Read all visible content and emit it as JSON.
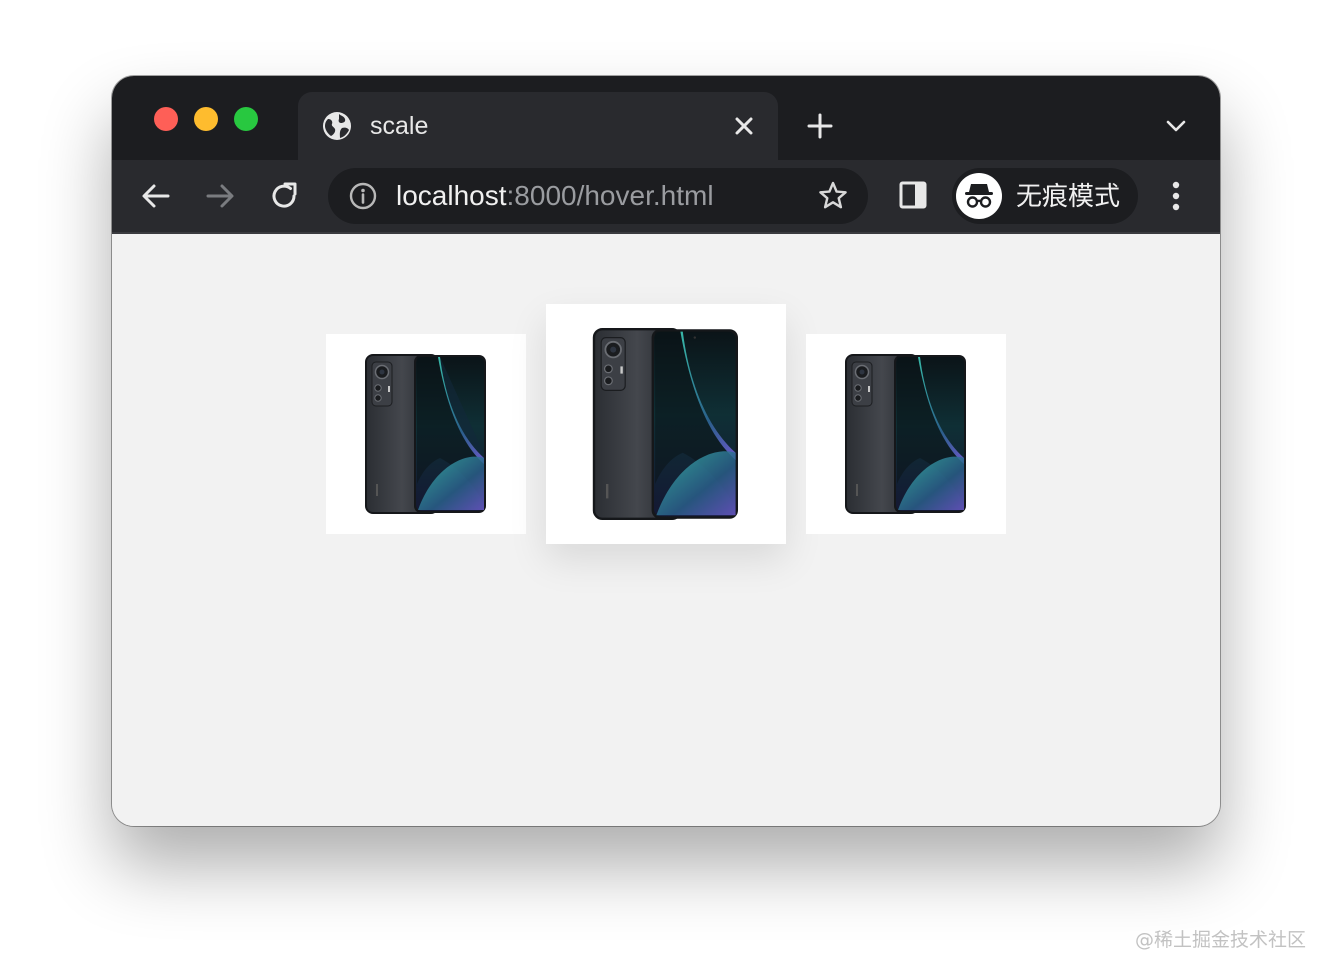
{
  "window": {
    "traffic_lights": {
      "close_color": "#fe5f57",
      "minimize_color": "#febc2e",
      "zoom_color": "#28c840"
    }
  },
  "tab": {
    "title": "scale",
    "icon": "globe-icon",
    "close_icon": "close-icon"
  },
  "tabstrip": {
    "new_tab_icon": "plus-icon",
    "tab_search_icon": "chevron-down-icon"
  },
  "toolbar": {
    "back_icon": "arrow-left-icon",
    "forward_icon": "arrow-right-icon",
    "reload_icon": "reload-icon",
    "site_info_icon": "info-icon",
    "bookmark_icon": "star-icon",
    "side_panel_icon": "side-panel-icon",
    "menu_icon": "kebab-menu-icon"
  },
  "omnibox": {
    "host": "localhost",
    "rest": ":8000/hover.html"
  },
  "incognito": {
    "icon": "incognito-icon",
    "label": "无痕模式"
  },
  "cards": [
    {
      "name": "phone-card-1",
      "image": "phone-image",
      "state": "normal"
    },
    {
      "name": "phone-card-2",
      "image": "phone-image",
      "state": "hover-scaled"
    },
    {
      "name": "phone-card-3",
      "image": "phone-image",
      "state": "normal"
    }
  ],
  "watermark": {
    "text": "@稀土掘金技术社区"
  }
}
